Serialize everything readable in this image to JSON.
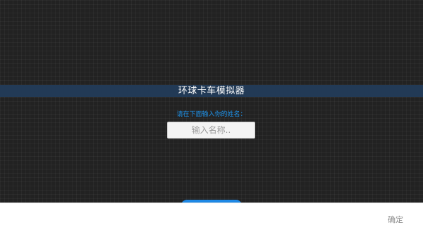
{
  "app": {
    "title": "环球卡车模拟器"
  },
  "name_prompt": {
    "label": "请在下面输入你的姓名：",
    "input_placeholder": "输入名称..",
    "input_value": ""
  },
  "dialog": {
    "confirm_label": "确定"
  },
  "colors": {
    "background": "#222222",
    "title_bar": "#223a56",
    "accent": "#1e88e5",
    "prompt_text": "#1e90e6"
  }
}
